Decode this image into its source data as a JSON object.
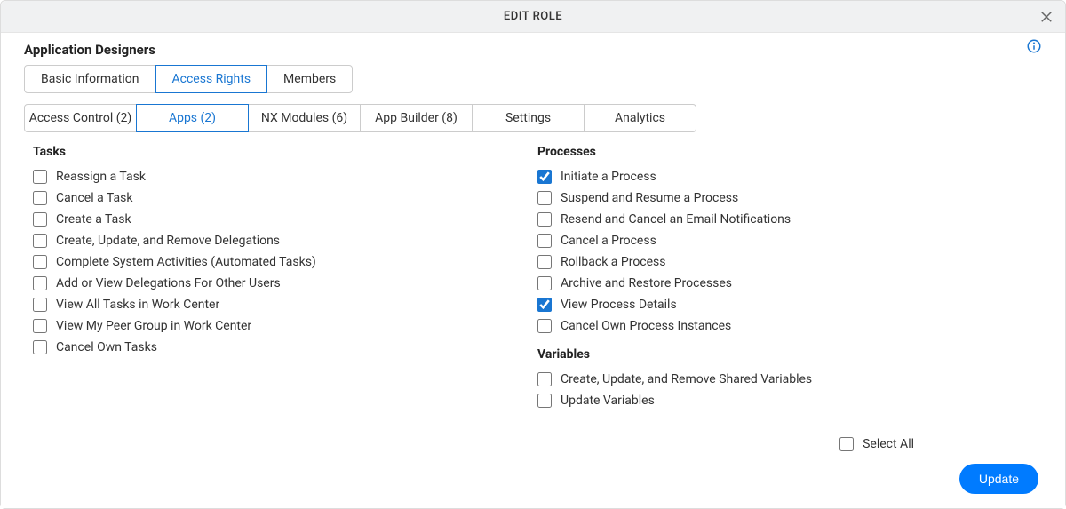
{
  "header": {
    "title": "EDIT ROLE"
  },
  "role_name": "Application Designers",
  "main_tabs": [
    {
      "label": "Basic Information",
      "active": false
    },
    {
      "label": "Access Rights",
      "active": true
    },
    {
      "label": "Members",
      "active": false
    }
  ],
  "sub_tabs": [
    {
      "label": "Access Control (2)",
      "active": false
    },
    {
      "label": "Apps (2)",
      "active": true
    },
    {
      "label": "NX Modules (6)",
      "active": false
    },
    {
      "label": "App Builder (8)",
      "active": false
    },
    {
      "label": "Settings",
      "active": false
    },
    {
      "label": "Analytics",
      "active": false
    }
  ],
  "sections": {
    "tasks": {
      "title": "Tasks",
      "items": [
        {
          "label": "Reassign a Task",
          "checked": false
        },
        {
          "label": "Cancel a Task",
          "checked": false
        },
        {
          "label": "Create a Task",
          "checked": false
        },
        {
          "label": "Create, Update, and Remove Delegations",
          "checked": false
        },
        {
          "label": "Complete System Activities (Automated Tasks)",
          "checked": false
        },
        {
          "label": "Add or View Delegations For Other Users",
          "checked": false
        },
        {
          "label": "View All Tasks in Work Center",
          "checked": false
        },
        {
          "label": "View My Peer Group in Work Center",
          "checked": false
        },
        {
          "label": "Cancel Own Tasks",
          "checked": false
        }
      ]
    },
    "processes": {
      "title": "Processes",
      "items": [
        {
          "label": "Initiate a Process",
          "checked": true
        },
        {
          "label": "Suspend and Resume a Process",
          "checked": false
        },
        {
          "label": "Resend and Cancel an Email Notifications",
          "checked": false
        },
        {
          "label": "Cancel a Process",
          "checked": false
        },
        {
          "label": "Rollback a Process",
          "checked": false
        },
        {
          "label": "Archive and Restore Processes",
          "checked": false
        },
        {
          "label": "View Process Details",
          "checked": true
        },
        {
          "label": "Cancel Own Process Instances",
          "checked": false
        }
      ]
    },
    "variables": {
      "title": "Variables",
      "items": [
        {
          "label": "Create, Update, and Remove Shared Variables",
          "checked": false
        },
        {
          "label": "Update Variables",
          "checked": false
        }
      ]
    }
  },
  "select_all": {
    "label": "Select All",
    "checked": false
  },
  "footer": {
    "update_label": "Update"
  }
}
